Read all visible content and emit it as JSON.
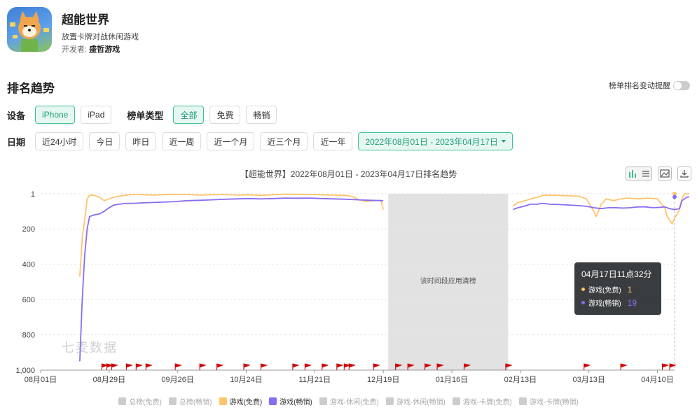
{
  "app": {
    "title": "超能世界",
    "subtitle": "放置卡牌对战休闲游戏",
    "developer_label": "开发者:",
    "developer": "盛哲游戏"
  },
  "section": {
    "title": "排名趋势",
    "toggle_label": "榜单排名变动提醒"
  },
  "filters": {
    "device_label": "设备",
    "devices": [
      "iPhone",
      "iPad"
    ],
    "chart_type_label": "榜单类型",
    "chart_types": [
      "全部",
      "免费",
      "畅销"
    ],
    "date_label": "日期",
    "dates": [
      "近24小时",
      "今日",
      "昨日",
      "近一周",
      "近一个月",
      "近三个月",
      "近一年"
    ],
    "date_range": "2022年08月01日 - 2023年04月17日"
  },
  "chart_data": {
    "type": "line",
    "title": "【超能世界】2022年08月01日 - 2023年04月17日排名趋势",
    "y_ticks": [
      "1",
      "200",
      "400",
      "600",
      "800",
      "1,000"
    ],
    "y_range": [
      1,
      1000
    ],
    "y_inverted": true,
    "x_ticks": [
      "08月01日",
      "08月29日",
      "09月26日",
      "10月24日",
      "11月21日",
      "12月19日",
      "01月16日",
      "02月13日",
      "03月13日",
      "04月10日"
    ],
    "gap_label": "该时间段应用清榜",
    "watermark": "七麦数据",
    "series": [
      {
        "name": "游戏(免费)",
        "color": "#ffc46b",
        "points": [
          [
            16,
            470
          ],
          [
            17,
            250
          ],
          [
            18,
            150
          ],
          [
            19,
            30
          ],
          [
            20,
            8
          ],
          [
            22,
            10
          ],
          [
            24,
            20
          ],
          [
            26,
            40
          ],
          [
            28,
            30
          ],
          [
            30,
            20
          ],
          [
            32,
            15
          ],
          [
            35,
            8
          ],
          [
            38,
            5
          ],
          [
            42,
            6
          ],
          [
            46,
            8
          ],
          [
            50,
            6
          ],
          [
            55,
            4
          ],
          [
            60,
            5
          ],
          [
            65,
            8
          ],
          [
            70,
            6
          ],
          [
            75,
            5
          ],
          [
            80,
            8
          ],
          [
            85,
            6
          ],
          [
            90,
            10
          ],
          [
            95,
            6
          ],
          [
            100,
            3
          ],
          [
            105,
            4
          ],
          [
            110,
            5
          ],
          [
            115,
            6
          ],
          [
            120,
            8
          ],
          [
            125,
            10
          ],
          [
            128,
            20
          ],
          [
            130,
            35
          ],
          [
            133,
            45
          ],
          [
            136,
            40
          ],
          [
            139,
            38
          ],
          [
            140,
            90
          ],
          [
            193,
            70
          ],
          [
            195,
            50
          ],
          [
            198,
            40
          ],
          [
            200,
            30
          ],
          [
            203,
            20
          ],
          [
            205,
            10
          ],
          [
            208,
            8
          ],
          [
            212,
            10
          ],
          [
            216,
            12
          ],
          [
            220,
            15
          ],
          [
            223,
            30
          ],
          [
            226,
            100
          ],
          [
            227,
            130
          ],
          [
            229,
            60
          ],
          [
            231,
            30
          ],
          [
            234,
            40
          ],
          [
            237,
            30
          ],
          [
            240,
            25
          ],
          [
            244,
            30
          ],
          [
            248,
            25
          ],
          [
            252,
            30
          ],
          [
            255,
            80
          ],
          [
            256,
            130
          ],
          [
            258,
            170
          ],
          [
            259,
            140
          ],
          [
            261,
            90
          ],
          [
            262,
            30
          ],
          [
            263,
            2
          ],
          [
            265,
            1
          ]
        ]
      },
      {
        "name": "游戏(畅销)",
        "color": "#8a6cf2",
        "points": [
          [
            16,
            950
          ],
          [
            17,
            600
          ],
          [
            18,
            350
          ],
          [
            19,
            200
          ],
          [
            20,
            130
          ],
          [
            22,
            120
          ],
          [
            24,
            115
          ],
          [
            26,
            100
          ],
          [
            28,
            80
          ],
          [
            30,
            65
          ],
          [
            32,
            60
          ],
          [
            35,
            55
          ],
          [
            38,
            55
          ],
          [
            42,
            52
          ],
          [
            46,
            50
          ],
          [
            50,
            48
          ],
          [
            55,
            45
          ],
          [
            60,
            40
          ],
          [
            65,
            38
          ],
          [
            70,
            35
          ],
          [
            75,
            32
          ],
          [
            80,
            30
          ],
          [
            85,
            28
          ],
          [
            90,
            30
          ],
          [
            95,
            28
          ],
          [
            100,
            25
          ],
          [
            105,
            26
          ],
          [
            110,
            25
          ],
          [
            115,
            28
          ],
          [
            120,
            30
          ],
          [
            125,
            32
          ],
          [
            130,
            35
          ],
          [
            135,
            38
          ],
          [
            140,
            40
          ],
          [
            193,
            90
          ],
          [
            195,
            80
          ],
          [
            198,
            70
          ],
          [
            200,
            60
          ],
          [
            203,
            60
          ],
          [
            205,
            55
          ],
          [
            208,
            60
          ],
          [
            212,
            62
          ],
          [
            216,
            65
          ],
          [
            220,
            68
          ],
          [
            223,
            72
          ],
          [
            226,
            80
          ],
          [
            229,
            85
          ],
          [
            232,
            80
          ],
          [
            235,
            80
          ],
          [
            238,
            82
          ],
          [
            241,
            80
          ],
          [
            244,
            75
          ],
          [
            247,
            75
          ],
          [
            250,
            80
          ],
          [
            253,
            78
          ],
          [
            255,
            75
          ],
          [
            257,
            85
          ],
          [
            259,
            90
          ],
          [
            261,
            85
          ],
          [
            262,
            40
          ],
          [
            264,
            20
          ],
          [
            265,
            19
          ]
        ]
      }
    ],
    "legend": [
      {
        "name": "总榜(免费)",
        "active": false
      },
      {
        "name": "总榜(畅销)",
        "active": false
      },
      {
        "name": "游戏(免费)",
        "active": true,
        "color": "#ffc46b"
      },
      {
        "name": "游戏(畅销)",
        "active": true,
        "color": "#8a6cf2"
      },
      {
        "name": "游戏-休闲(免费)",
        "active": false
      },
      {
        "name": "游戏-休闲(畅销)",
        "active": false
      },
      {
        "name": "游戏-卡牌(免费)",
        "active": false
      },
      {
        "name": "游戏-卡牌(畅销)",
        "active": false
      }
    ]
  },
  "tooltip": {
    "title": "04月17日11点32分",
    "rows": [
      {
        "label": "游戏(免费)",
        "value": "1",
        "color": "#ffc46b"
      },
      {
        "label": "游戏(畅销)",
        "value": "19",
        "color": "#8a6cf2"
      }
    ]
  }
}
